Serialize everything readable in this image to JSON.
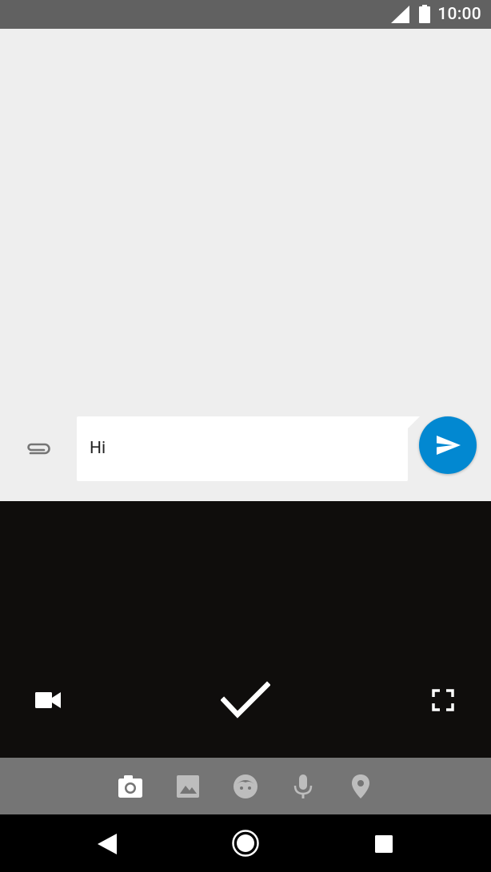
{
  "status_bar": {
    "time": "10:00"
  },
  "compose": {
    "text": "Hi"
  },
  "colors": {
    "status_bar_bg": "#616161",
    "conversation_bg": "#eeeeee",
    "send_button": "#0288d1",
    "camera_bg": "#0f0d0c",
    "media_bar_bg": "#757575",
    "nav_bar_bg": "#000000"
  },
  "icons": {
    "status": [
      "signal-icon",
      "battery-icon"
    ],
    "compose": [
      "paperclip-icon",
      "send-icon"
    ],
    "camera": [
      "video-camera-icon",
      "checkmark-icon",
      "fullscreen-icon"
    ],
    "media_bar": [
      "camera-icon",
      "gallery-icon",
      "sticker-icon",
      "microphone-icon",
      "location-icon"
    ],
    "navigation": [
      "back-icon",
      "home-icon",
      "recents-icon"
    ]
  },
  "media_bar": {
    "selected": "camera-icon"
  }
}
